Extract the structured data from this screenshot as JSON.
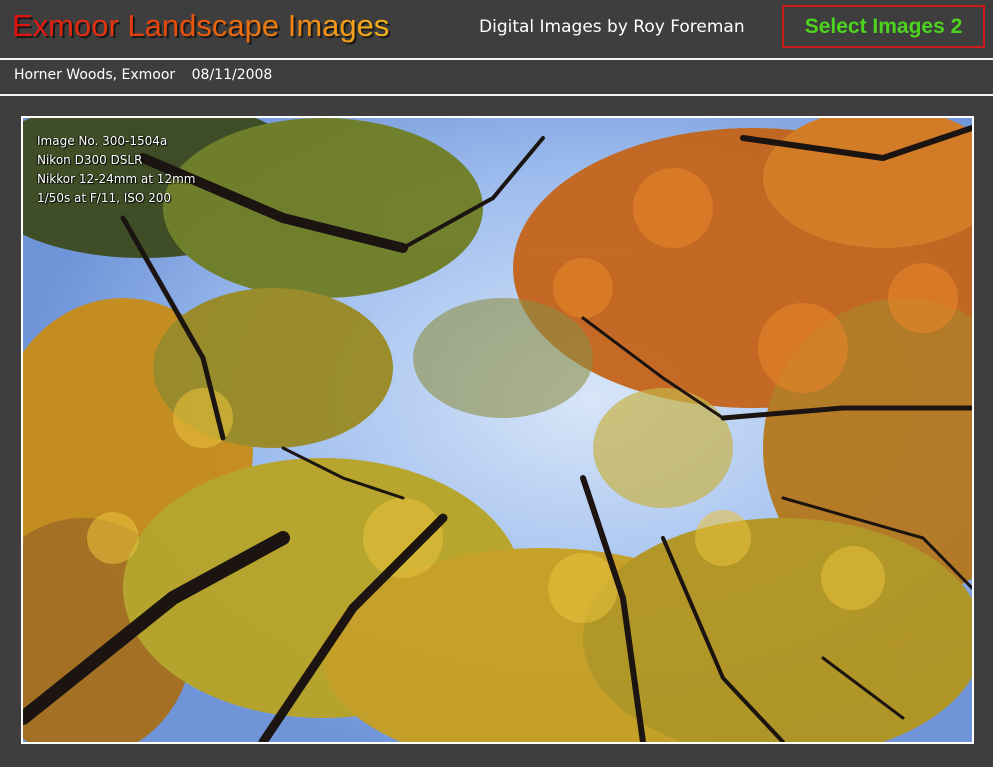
{
  "header": {
    "title": "Exmoor Landscape Images",
    "subtitle": "Digital Images by Roy Foreman",
    "select_button": "Select Images 2"
  },
  "caption": {
    "location": "Horner Woods, Exmoor",
    "date": "08/11/2008"
  },
  "photo": {
    "exif": {
      "image_no": "Image No. 300-1504a",
      "camera": "Nikon D300 DSLR",
      "lens": "Nikkor 12-24mm at 12mm",
      "settings": "1/50s at F/11, ISO 200"
    }
  },
  "colors": {
    "background": "#3e3e3e",
    "title_gradient_start": "#e01010",
    "title_gradient_end": "#f6b21a",
    "button_text": "#4cd41e",
    "button_border": "#cc1a1a",
    "sky": "#8fb3e8"
  }
}
